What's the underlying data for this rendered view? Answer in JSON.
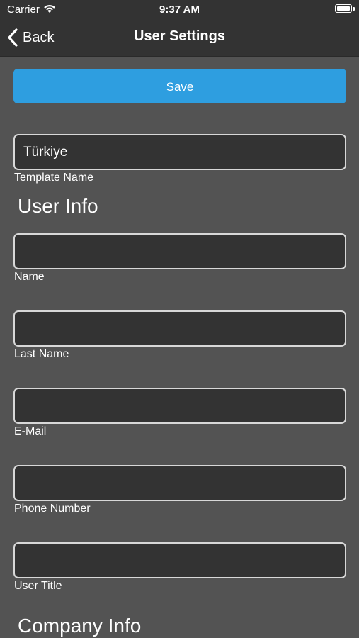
{
  "status_bar": {
    "carrier": "Carrier",
    "time": "9:37 AM"
  },
  "nav": {
    "back_label": "Back",
    "title": "User Settings"
  },
  "actions": {
    "save_label": "Save"
  },
  "template": {
    "value": "Türkiye",
    "label": "Template Name"
  },
  "sections": {
    "user_info": "User Info",
    "company_info": "Company Info"
  },
  "user_fields": {
    "name_label": "Name",
    "name_value": "",
    "last_name_label": "Last Name",
    "last_name_value": "",
    "email_label": "E-Mail",
    "email_value": "",
    "phone_label": "Phone Number",
    "phone_value": "",
    "title_label": "User Title",
    "title_value": ""
  },
  "colors": {
    "background": "#535353",
    "bar": "#333333",
    "field_fill": "#333333",
    "field_border": "#d8d8d8",
    "accent": "#2e9ee0",
    "text": "#ffffff"
  },
  "icons": {
    "wifi": "wifi-icon",
    "battery": "battery-icon",
    "back": "chevron-left-icon"
  }
}
